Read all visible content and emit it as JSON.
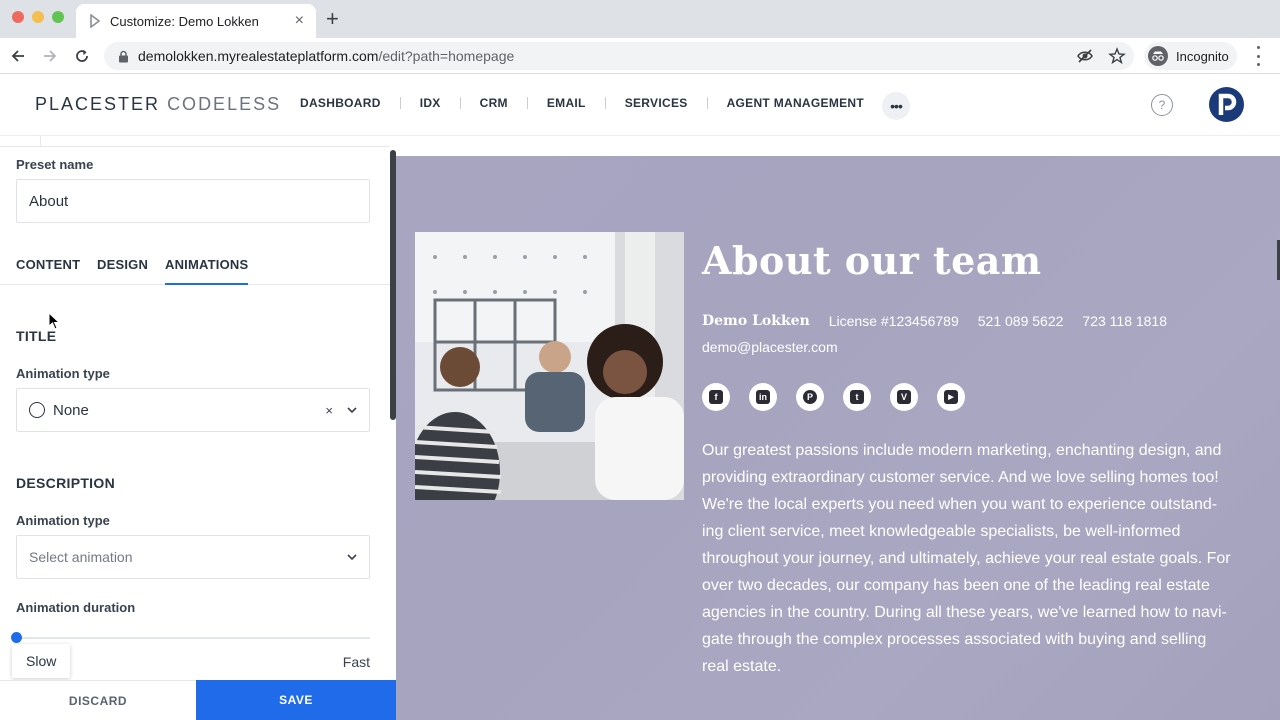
{
  "browser": {
    "tab_title": "Customize: Demo Lokken",
    "url_host": "demolokken.myrealestateplatform.com",
    "url_path": "/edit?path=homepage",
    "incognito_label": "Incognito",
    "close_glyph": "×",
    "newtab_glyph": "+"
  },
  "app": {
    "logo_bold": "PLACESTER",
    "logo_light": "CODELESS",
    "nav": [
      "DASHBOARD",
      "IDX",
      "CRM",
      "EMAIL",
      "SERVICES",
      "AGENT MANAGEMENT"
    ],
    "more_glyph": "•••",
    "help_glyph": "?"
  },
  "panel": {
    "preset_label": "Preset name",
    "preset_value": "About",
    "tabs": [
      "CONTENT",
      "DESIGN",
      "ANIMATIONS"
    ],
    "active_tab": "ANIMATIONS",
    "title_section": "TITLE",
    "title_anim_label": "Animation type",
    "title_anim_value": "None",
    "clear_glyph": "×",
    "desc_section": "DESCRIPTION",
    "desc_anim_label": "Animation type",
    "desc_anim_placeholder": "Select animation",
    "duration_label": "Animation duration",
    "duration_value_fraction": 0,
    "slow_label": "Slow",
    "fast_label": "Fast",
    "discard_label": "DISCARD",
    "save_label": "SAVE",
    "accent_color": "#1f6bea"
  },
  "preview": {
    "title": "About our team",
    "agent_name": "Demo Lokken",
    "license": "License #123456789",
    "phone1": "521 089 5622",
    "phone2": "723 118 1818",
    "email": "demo@placester.com",
    "socials": [
      {
        "name": "facebook-icon",
        "glyph": "f"
      },
      {
        "name": "linkedin-icon",
        "glyph": "in"
      },
      {
        "name": "pinterest-icon",
        "glyph": "P"
      },
      {
        "name": "twitter-icon",
        "glyph": "t"
      },
      {
        "name": "vimeo-icon",
        "glyph": "V"
      },
      {
        "name": "youtube-icon",
        "glyph": "▶"
      }
    ],
    "bio": [
      "Our greatest passions include modern marketing, enchanting design, and",
      "providing extraordinary customer service. And we love selling homes too!",
      "We're the local experts you need when you want to experience outstand-",
      "ing client service, meet knowledgeable specialists, be well-informed",
      "throughout your journey, and ultimately, achieve your real estate goals. For",
      "over two decades, our company has been one of the leading real estate",
      "agencies in the country. During all these years, we've learned how to navi-",
      "gate through the complex processes associated with buying and selling",
      "real estate."
    ],
    "hero_color": "#a7a5c0"
  }
}
